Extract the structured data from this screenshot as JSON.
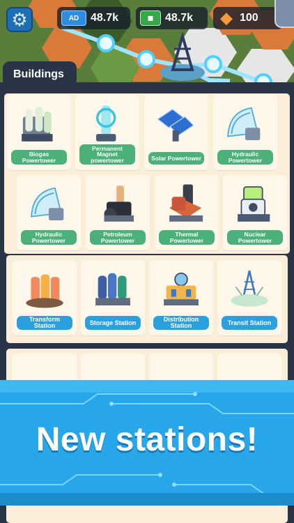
{
  "resources": {
    "ad_badge": "AD",
    "ad_amount": "48.7k",
    "cash_amount": "48.7k",
    "gem_amount": "100"
  },
  "panel": {
    "tab_label": "Buildings"
  },
  "power_row1": [
    {
      "label": "Biogas Powertower",
      "icon": "biogas-icon"
    },
    {
      "label": "Permanent Magnet powertower",
      "icon": "magnet-icon"
    },
    {
      "label": "Solar Powertower",
      "icon": "solar-panel-icon"
    },
    {
      "label": "Hydraulic Powertower",
      "icon": "hydraulic-icon"
    }
  ],
  "power_row2": [
    {
      "label": "Hydraulic Powertower",
      "icon": "hydraulic-icon"
    },
    {
      "label": "Petroleum Powertower",
      "icon": "petroleum-icon"
    },
    {
      "label": "Thermal Powertower",
      "icon": "thermal-icon"
    },
    {
      "label": "Nuclear Powertower",
      "icon": "nuclear-icon"
    }
  ],
  "stations": [
    {
      "label": "Transform Station",
      "icon": "transform-icon"
    },
    {
      "label": "Storage Station",
      "icon": "storage-icon"
    },
    {
      "label": "Distribution Station",
      "icon": "distribution-icon"
    },
    {
      "label": "Transit Station",
      "icon": "transit-icon"
    }
  ],
  "banner": {
    "headline": "New stations!"
  },
  "colors": {
    "accent_blue": "#2aa0de",
    "label_green": "#4cb07a",
    "panel_bg": "#2a3447",
    "card_bg": "#fff8ea",
    "banner_blue": "#27a6ea"
  }
}
